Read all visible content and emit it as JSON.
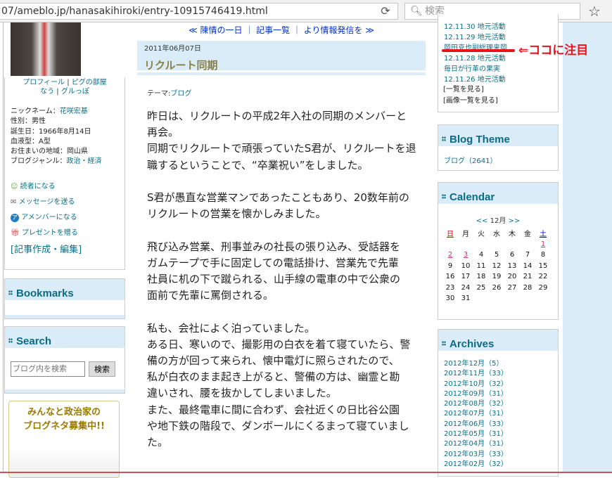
{
  "browser": {
    "url": "07/ameblo.jp/hanasakihiroki/entry-10915746419.html",
    "search_placeholder": "検索"
  },
  "profile": {
    "links1": [
      "プロフィール",
      "ピグの部屋"
    ],
    "links2": [
      "なう",
      "グルっぽ"
    ],
    "nickname_label": "ニックネーム：",
    "nickname": "花咲宏基",
    "gender": "性別：男性",
    "birthday": "誕生日：1966年8月14日",
    "blood": "血液型：A型",
    "area": "お住まいの地域：岡山県",
    "genre_label": "ブログジャンル：",
    "genre": "政治・経済",
    "actions": [
      "読者になる",
      "メッセージを送る",
      "アメンバーになる",
      "プレゼントを贈る"
    ],
    "edit": "[記事作成・編集]"
  },
  "bookmarks": {
    "title": "Bookmarks"
  },
  "search": {
    "title": "Search",
    "placeholder": "ブログ内を検索",
    "button": "検索"
  },
  "banner": {
    "line1": "みんなと政治家の",
    "line2": "ブログネタ募集中!!"
  },
  "nav": {
    "prev": "≪ 陳情の一日",
    "list": "記事一覧",
    "next": "より情報発信を ≫"
  },
  "entry": {
    "date": "2011年06月07日",
    "title": "リクルート同期",
    "theme_label": "テーマ:",
    "theme": "ブログ",
    "lines": [
      "昨日は、リクルートの平成2年入社の同期のメンバーと",
      "再会。",
      "同期でリクルートで頑張っていたS君が、リクルートを退",
      "職するということで、“卒業祝い”をしました。",
      "",
      "S君が愚直な営業マンであったこともあり、20数年前の",
      "リクルートの営業を懐かしみました。",
      "",
      "飛び込み営業、刑事並みの社長の張り込み、受話器を",
      "ガムテープで手に固定しての電話掛け、営業先で先輩",
      "社員に机の下で蹴られる、山手線の電車の中で公衆の",
      "面前で先輩に罵倒される。",
      "",
      "私も、会社によく泊っていました。",
      "ある日、寒いので、撮影用の白衣を着て寝ていたら、警",
      "備の方が回って来られ、懐中電灯に照らされたので、",
      "私が白衣のまま起き上がると、警備の方は、幽霊と勘",
      "違いされ、腰を抜かしてしまいました。",
      "また、最終電車に間に合わず、会社近くの日比谷公園",
      "や地下鉄の階段で、ダンボールにくるまって寝ていまし",
      "た。"
    ]
  },
  "recent": {
    "items": [
      "12.11.30 地元活動",
      "12.11.29 地元活動",
      "岡田克也副総理来岡",
      "12.11.28 地元活動",
      "毎日が行革の果実",
      "12.11.26 地元活動"
    ],
    "more": "[一覧を見る]",
    "images": "[画像一覧を見る]"
  },
  "annotation": "⇐ココに注目",
  "theme_box": {
    "title": "Blog Theme",
    "item": "ブログ（2641）"
  },
  "calendar": {
    "title": "Calendar",
    "prev": "<<",
    "month": "12月",
    "next": ">>",
    "weekdays": [
      "日",
      "月",
      "火",
      "水",
      "木",
      "金",
      "土"
    ],
    "weeks": [
      [
        "",
        "",
        "",
        "",
        "",
        "",
        "1"
      ],
      [
        "2",
        "3",
        "4",
        "5",
        "6",
        "7",
        "8"
      ],
      [
        "9",
        "10",
        "11",
        "12",
        "13",
        "14",
        "15"
      ],
      [
        "16",
        "17",
        "18",
        "19",
        "20",
        "21",
        "22"
      ],
      [
        "23",
        "24",
        "25",
        "26",
        "27",
        "28",
        "29"
      ],
      [
        "30",
        "31",
        "",
        "",
        "",
        "",
        ""
      ]
    ],
    "linked": [
      "1",
      "2",
      "3"
    ]
  },
  "archives": {
    "title": "Archives",
    "items": [
      "2012年12月（5）",
      "2012年11月（33）",
      "2012年10月（32）",
      "2012年09月（31）",
      "2012年08月（32）",
      "2012年07月（31）",
      "2012年06月（33）",
      "2012年05月（31）",
      "2012年04月（31）",
      "2012年03月（33）",
      "2012年02月（32）"
    ]
  }
}
